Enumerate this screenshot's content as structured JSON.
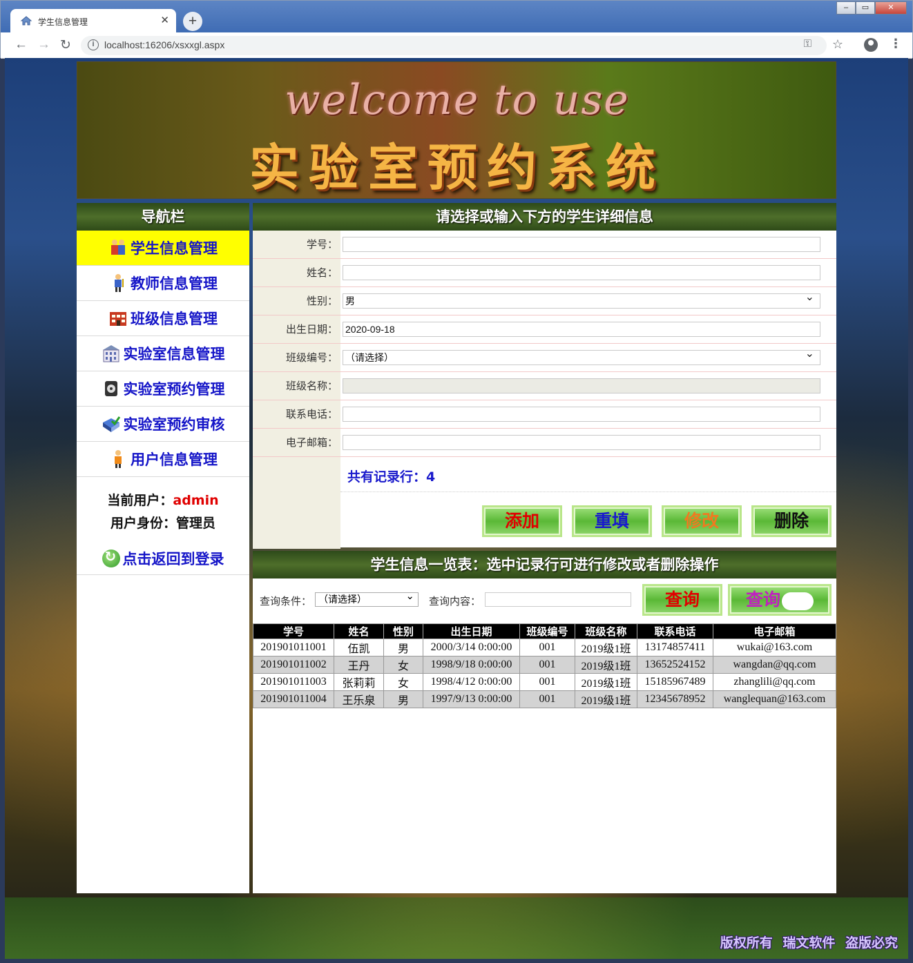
{
  "browser": {
    "tab_title": "学生信息管理",
    "url": "localhost:16206/xsxxgl.aspx"
  },
  "banner": {
    "welcome": "welcome to use",
    "system_name": "实验室预约系统"
  },
  "sidebar": {
    "title": "导航栏",
    "items": [
      {
        "label": "学生信息管理",
        "icon": "students-icon",
        "active": true
      },
      {
        "label": "教师信息管理",
        "icon": "teacher-icon",
        "active": false
      },
      {
        "label": "班级信息管理",
        "icon": "class-icon",
        "active": false
      },
      {
        "label": "实验室信息管理",
        "icon": "building-icon",
        "active": false
      },
      {
        "label": "实验室预约管理",
        "icon": "phone-icon",
        "active": false
      },
      {
        "label": "实验室预约审核",
        "icon": "book-check-icon",
        "active": false
      },
      {
        "label": "用户信息管理",
        "icon": "user-icon",
        "active": false
      }
    ],
    "current_user_label": "当前用户：",
    "current_user": "admin",
    "role_label": "用户身份：",
    "role": "管理员",
    "relogin": "点击返回到登录"
  },
  "form": {
    "title": "请选择或输入下方的学生详细信息",
    "fields": [
      {
        "label": "学号：",
        "value": ""
      },
      {
        "label": "姓名：",
        "value": ""
      },
      {
        "label": "性别：",
        "value": "男"
      },
      {
        "label": "出生日期：",
        "value": "2020-09-18"
      },
      {
        "label": "班级编号：",
        "value": "（请选择）"
      },
      {
        "label": "班级名称：",
        "value": ""
      },
      {
        "label": "联系电话：",
        "value": ""
      },
      {
        "label": "电子邮箱：",
        "value": ""
      }
    ],
    "record_count": "共有记录行：4",
    "buttons": {
      "add": "添加",
      "reset": "重填",
      "edit": "修改",
      "delete": "删除"
    },
    "button_colors": {
      "add": "#e00000",
      "reset": "#1a1acc",
      "edit": "#f07a20",
      "delete": "#111111"
    }
  },
  "list": {
    "title": "学生信息一览表：选中记录行可进行修改或者删除操作",
    "query_condition_label": "查询条件：",
    "query_condition_value": "（请选择）",
    "query_content_label": "查询内容：",
    "query_button": "查询",
    "query_button2": "查询",
    "columns": [
      "学号",
      "姓名",
      "性别",
      "出生日期",
      "班级编号",
      "班级名称",
      "联系电话",
      "电子邮箱"
    ],
    "rows": [
      [
        "201901011001",
        "伍凯",
        "男",
        "2000/3/14 0:00:00",
        "001",
        "2019级1班",
        "13174857411",
        "wukai@163.com"
      ],
      [
        "201901011002",
        "王丹",
        "女",
        "1998/9/18 0:00:00",
        "001",
        "2019级1班",
        "13652524152",
        "wangdan@qq.com"
      ],
      [
        "201901011003",
        "张莉莉",
        "女",
        "1998/4/12 0:00:00",
        "001",
        "2019级1班",
        "15185967489",
        "zhanglili@qq.com"
      ],
      [
        "201901011004",
        "王乐泉",
        "男",
        "1997/9/13 0:00:00",
        "001",
        "2019级1班",
        "12345678952",
        "wanglequan@163.com"
      ]
    ]
  },
  "footer": "版权所有 瑞文软件 盗版必究"
}
